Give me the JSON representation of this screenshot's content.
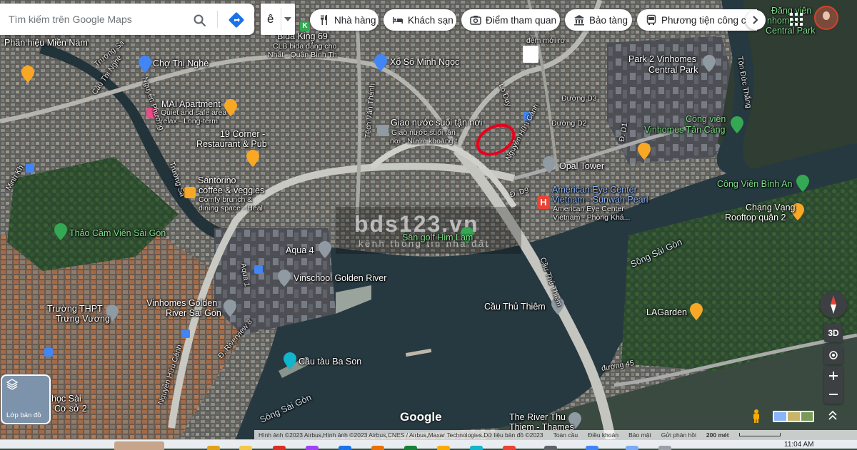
{
  "search": {
    "placeholder": "Tìm kiếm trên Google Maps"
  },
  "lang_button": "ê",
  "categories": [
    {
      "label": "Nhà hàng",
      "icon": "fork-knife-icon"
    },
    {
      "label": "Khách sạn",
      "icon": "bed-icon"
    },
    {
      "label": "Điểm tham quan",
      "icon": "camera-icon"
    },
    {
      "label": "Bảo tàng",
      "icon": "museum-icon"
    },
    {
      "label": "Phương tiện công cộng",
      "icon": "bus-icon"
    }
  ],
  "map_labels": {
    "bida_king": "Bida King 69",
    "bida_sub1": "CLB bida đẳng cho",
    "bida_sub2": "Nhất - Quận Bình Th",
    "phan_hieu": "Phân hiệu Miền Nam",
    "cho_thi_nghe": "Chợ Thị Nghè",
    "xo_so": "Xổ Số Minh Ngọc",
    "mai_apartment": "MAI Apartment",
    "mai_sub1": "Quiet and safe area",
    "mai_sub2": "relax - Long-term",
    "giao_nuoc": "Giao nước suối tận nơi",
    "giao_sub1": "Giao nước suối tận",
    "giao_sub2": "nơi - Nước khoáng t",
    "corner_19": "19 Corner -",
    "corner_19b": "Restaurant & Pub",
    "santorino": "Santorino",
    "santorino2": "coffee & veggies",
    "santorino_sub1": "Comfy brunch &",
    "santorino_sub2": "dining space - Heal",
    "thao_cam_vien": "Thảo Cầm Viên Sài Gòn",
    "aqua4": "Aqua 4",
    "aqua1": "Aqua 1",
    "vinschool": "Vinschool Golden River",
    "vinhomes_golden": "Vinhomes Golden",
    "vinhomes_golden2": "River Sài Gòn",
    "truong_thpt": "Trường THPT",
    "trung_vuong": "Trưng Vương",
    "cau_tau": "Cầu tàu Ba Son",
    "san_golf": "Sân golf Him Lam",
    "cau_thu_thiem": "Cầu Thủ Thiêm",
    "opal_tower": "Opal Tower",
    "american_eye": "American Eye Center",
    "american_eye2": "Vietnam - Sunwah Pearl",
    "american_sub1": "American Eye Center",
    "american_sub2": "Vietnam - Phòng Khá...",
    "park2": "Park 2 Vinhomes",
    "central_park": "Central Park",
    "cong_vien": "Công viên",
    "vinhomes_tan_cang": "Vinhomes Tân Cảng",
    "cong_vien_binh_an": "Công Viên Bình An",
    "chang_vang": "Chạng Vạng",
    "rooftop": "Rooftop quận 2",
    "song_sai_gon_1": "Sông Sài Gòn",
    "song_sai_gon_2": "Sông Sài Gòn",
    "lagarden": "LAGarden",
    "duong_d3": "Đường D3",
    "duong_d2": "Đường D2",
    "d_d9": "Đ. D9",
    "d_d1": "Đ. D1",
    "duong_45": "đường 45",
    "the_river": "The River Thu",
    "the_river2": "Thiem - Thames",
    "dang_vien": "Đăng viên",
    "vinhomes_top": "nhomes",
    "central_park_top": "Central Park",
    "nguyen_huu_canh": "Nguyễn Hữu Cảnh",
    "nguyen_huu_canh2": "Nguyễn Hữu Cảnh",
    "cau_thi_nghe": "Cầu Thị Nghè",
    "truong_sa": "Trường Sa",
    "truong_sa2": "Trường Sa",
    "nguyen_phuong": "Nguyễn Phương",
    "ton_duc_thang": "Tôn Đức Thắng",
    "riverview8": "Đ. Riverview 8",
    "cau_thu_thiem_road": "Cầu Thủ Thiêm",
    "minh_khai": "Minh Kh",
    "hoc_sai": "học Sài",
    "co_so_2": "Cơ sở 2",
    "dem_moi_ro": "đệm mới rơ",
    "tech_van_thanh": "Tệch Văn Thánh",
    "lo_duy": "Lô Duy",
    "google": "Google"
  },
  "watermark": {
    "title": "bds123.vn",
    "subtitle": "kênh thông tin nhà đất"
  },
  "layers": {
    "label": "Lớp bản đồ"
  },
  "controls": {
    "three_d": "3D"
  },
  "attribution": {
    "imagery": "Hình ảnh ©2023 Airbus,Hình ảnh ©2023 Airbus,CNES / Airbus,Maxar Technologies,Dữ liệu bản đồ ©2023",
    "global": "Toàn cầu",
    "terms": "Điều khoản",
    "privacy": "Bảo mật",
    "feedback": "Gửi phản hồi",
    "scale": "200 mét"
  },
  "taskbar": {
    "time": "11:04 AM"
  },
  "colors": {
    "pin_orange": "#f9a825",
    "pin_blue": "#4285f4",
    "pin_green": "#34a853",
    "pin_red": "#ea4335",
    "highlight": "#e8001c"
  }
}
